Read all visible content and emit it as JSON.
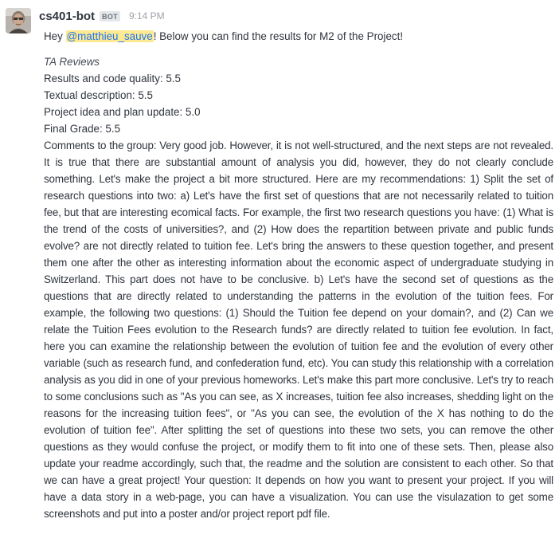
{
  "message": {
    "username": "cs401-bot",
    "badge": "BOT",
    "timestamp": "9:14 PM",
    "greeting_before": "Hey ",
    "mention": "@matthieu_sauve",
    "greeting_after": "! Below you can find the results for M2 of the Project!",
    "reviews": {
      "heading": "TA Reviews",
      "items": [
        "Results and code quality: 5.5",
        "Textual description: 5.5",
        "Project idea and plan update: 5.0",
        "Final Grade: 5.5"
      ]
    },
    "comments": "Comments to the group: Very good job. However, it is not well-structured, and the next steps are not revealed. It is true that there are substantial amount of analysis you did, however, they do not clearly conclude something. Let's make the project a bit more structured. Here are my recommendations:  1) Split the set of research questions into two:  a) Let's have the first set of questions that are not necessarily related to tuition fee, but that are interesting ecomical facts. For example, the first two research questions you have: (1) What is the trend of the costs of universities?, and (2) How does the repartition between private and public funds evolve? are not directly related to tuition fee. Let's bring the answers to these question together, and present them one after the other as interesting information about the economic aspect of undergraduate studying in Switzerland. This part does not have to be conclusive.  b) Let's have the second set of questions as the questions that are directly related to understanding the patterns in the evolution of the tuition fees. For example, the following two questions: (1) Should the Tuition fee depend on your domain?, and (2) Can we relate the Tuition Fees evolution to the Research funds? are directly related to tuition fee evolution. In fact, here you can examine the relationship between the evolution of tuition fee and the evolution of every other variable (such as research fund, and confederation fund, etc). You can study this relationship with a correlation analysis as you did in one of your previous homeworks. Let's make this part more conclusive. Let's try to reach to some conclusions such as \"As you can see, as X increases, tuition fee also increases, shedding light on the reasons for the increasing tuition fees\", or \"As you can see, the evolution of the X has nothing to do the evolution of tuition fee\". After splitting the set of questions into these two sets, you can remove the other questions as they would confuse the project, or modify them to fit into one of these sets. Then, please also update your readme accordingly, such that, the readme and the solution are consistent to each other. So that we can have a great project!  Your question: It depends on how you want to present your project. If you will have a data story in a web-page, you can have a visualization. You can use the visulazation to get some screenshots and put into a poster and/or project report pdf file."
  },
  "colors": {
    "mention_bg": "#fde992",
    "mention_text": "#1d74f5",
    "badge_bg": "#e4e7ea",
    "timestamp": "#9ea2a8"
  },
  "icons": {
    "avatar": "bot-avatar-icon"
  }
}
